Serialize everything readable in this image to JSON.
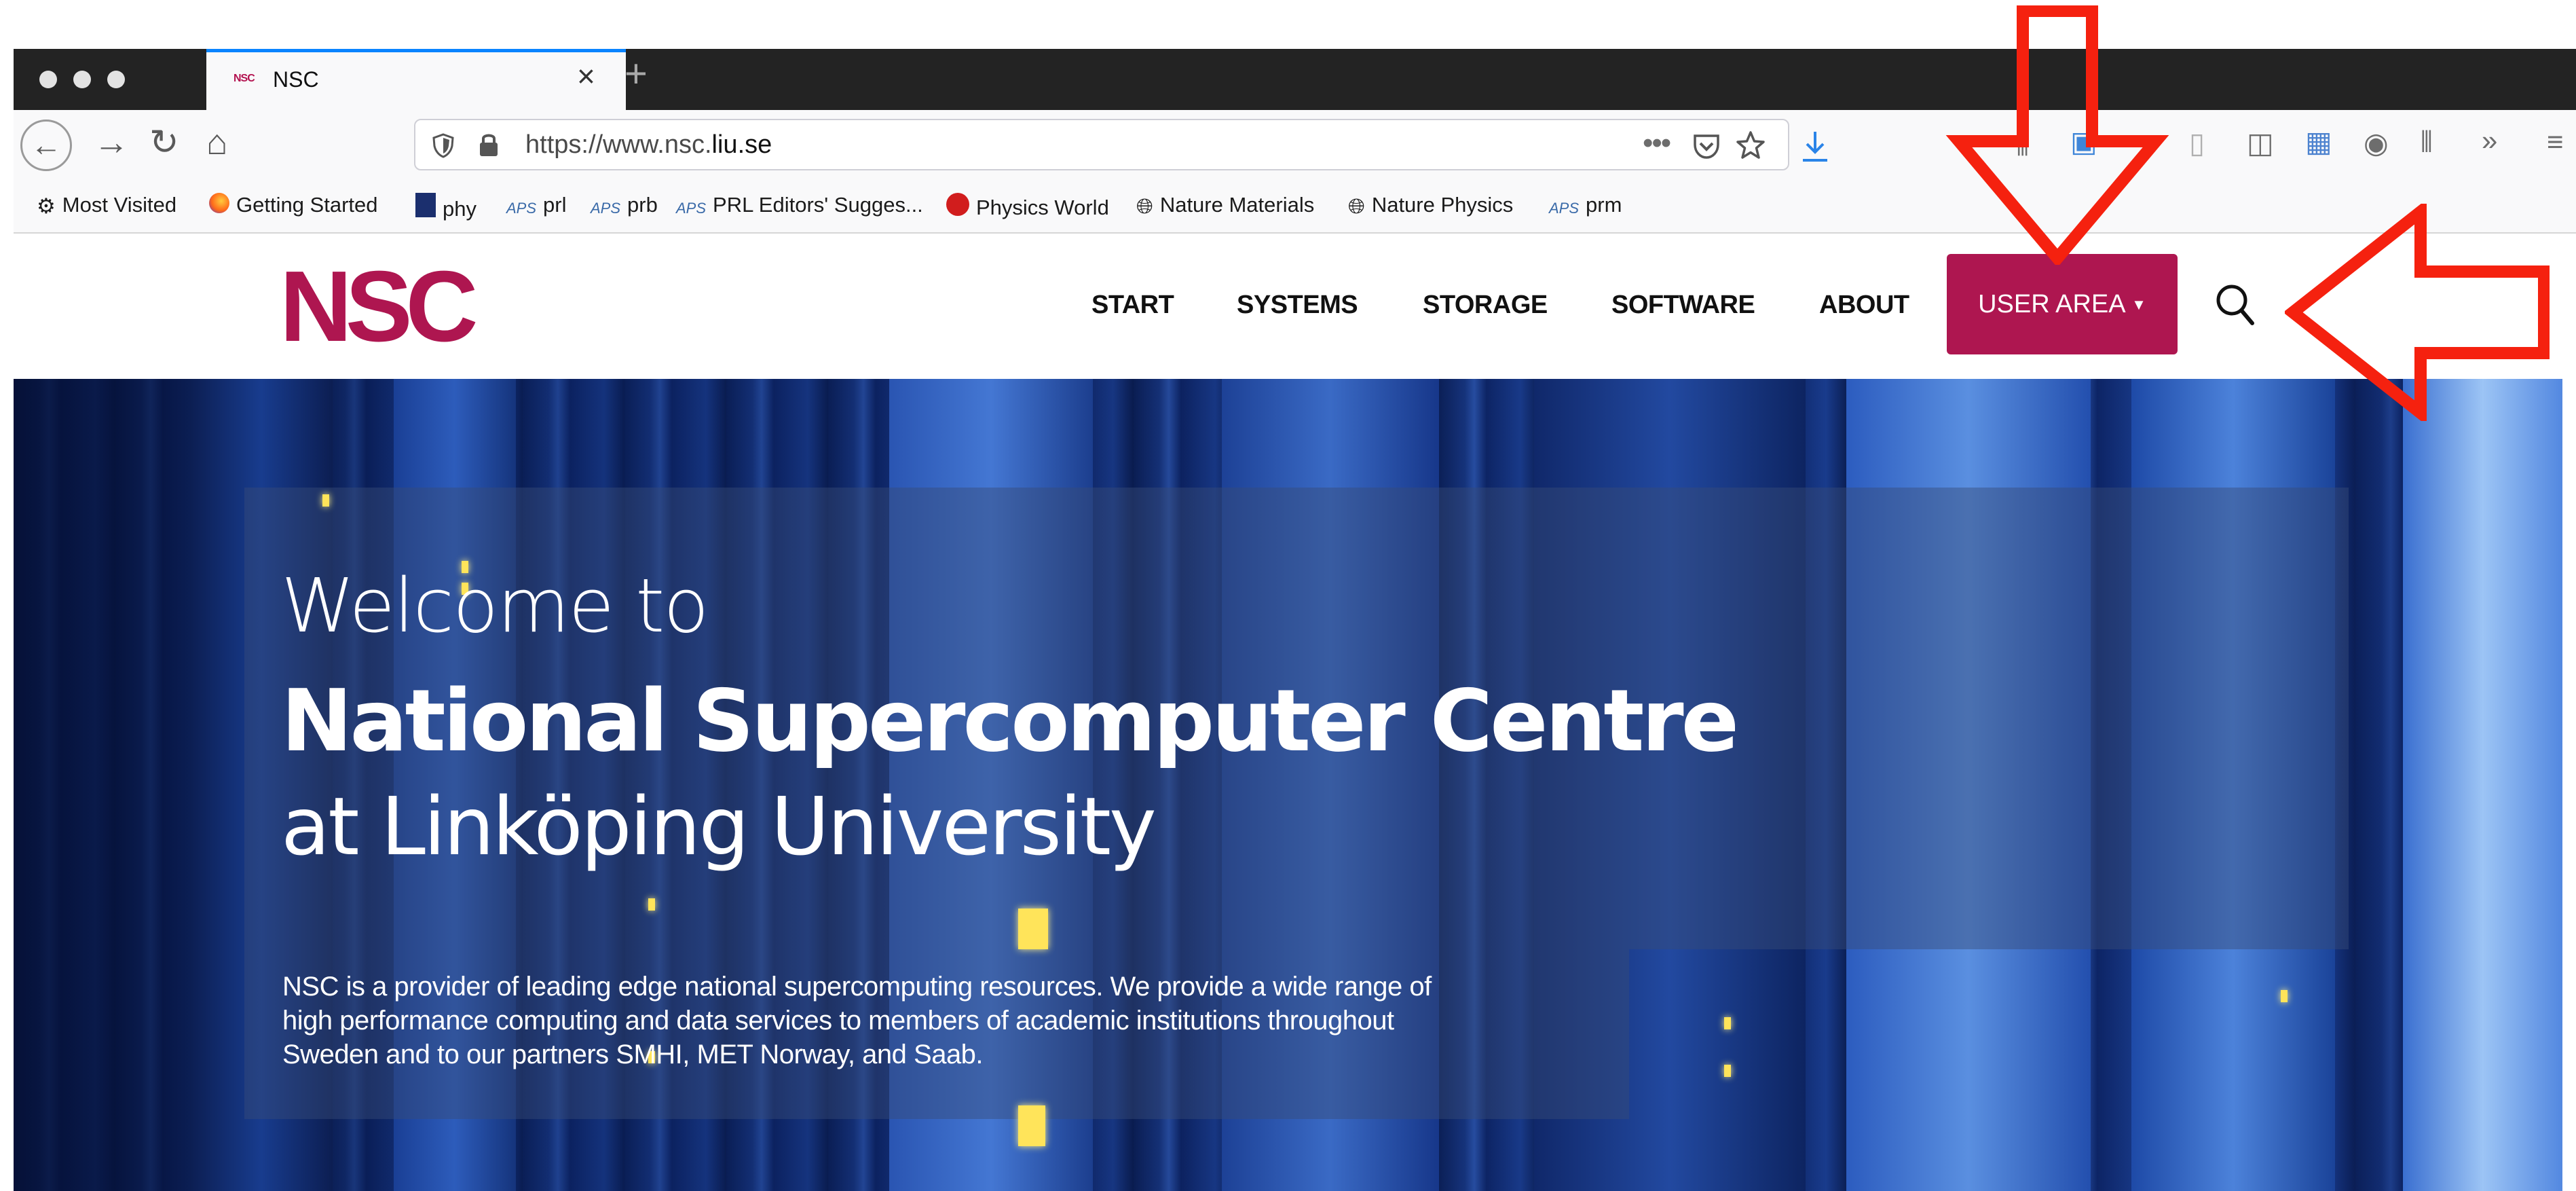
{
  "browser": {
    "tab_title": "NSC",
    "tab_favicon_text": "NSC",
    "url_prefix": "https://www.nsc.",
    "url_domain": "liu.se",
    "page_actions_icon": "ellipsis-icon",
    "toolbar_icons": [
      "library-icon",
      "sync-icon",
      "reader-view-icon",
      "sidebar-icon",
      "extension-icon",
      "account-icon",
      "bookmarks-manager-icon",
      "overflow-icon",
      "menu-icon"
    ]
  },
  "bookmarks": [
    {
      "label": "Most Visited",
      "icon": "gear-icon"
    },
    {
      "label": "Getting Started",
      "icon": "firefox-icon"
    },
    {
      "label": "phy",
      "icon": "document-icon"
    },
    {
      "label": "prl",
      "icon": "aps-icon"
    },
    {
      "label": "prb",
      "icon": "aps-icon"
    },
    {
      "label": "PRL Editors' Sugges...",
      "icon": "aps-icon"
    },
    {
      "label": "Physics World",
      "icon": "physics-world-icon"
    },
    {
      "label": "Nature Materials",
      "icon": "globe-icon"
    },
    {
      "label": "Nature Physics",
      "icon": "globe-icon"
    },
    {
      "label": "prm",
      "icon": "aps-icon"
    }
  ],
  "site": {
    "logo_text": "NSC",
    "nav": [
      "START",
      "SYSTEMS",
      "STORAGE",
      "SOFTWARE",
      "ABOUT"
    ],
    "user_area_label": "USER AREA",
    "brand_color": "#ae1650"
  },
  "hero": {
    "line1": "Welcome to",
    "line2": "National Supercomputer Centre",
    "line3": "at Linköping University",
    "intro_line1": "NSC is a provider of leading edge national supercomputing resources. We provide a wide range of",
    "intro_line2": "high performance computing and data services to members of academic institutions throughout",
    "intro_line3": "Sweden and to our partners SMHI, MET Norway, and Saab."
  },
  "annotations": {
    "arrow_color": "#f5210f",
    "targets": [
      "user-area-button",
      "search-icon"
    ]
  }
}
